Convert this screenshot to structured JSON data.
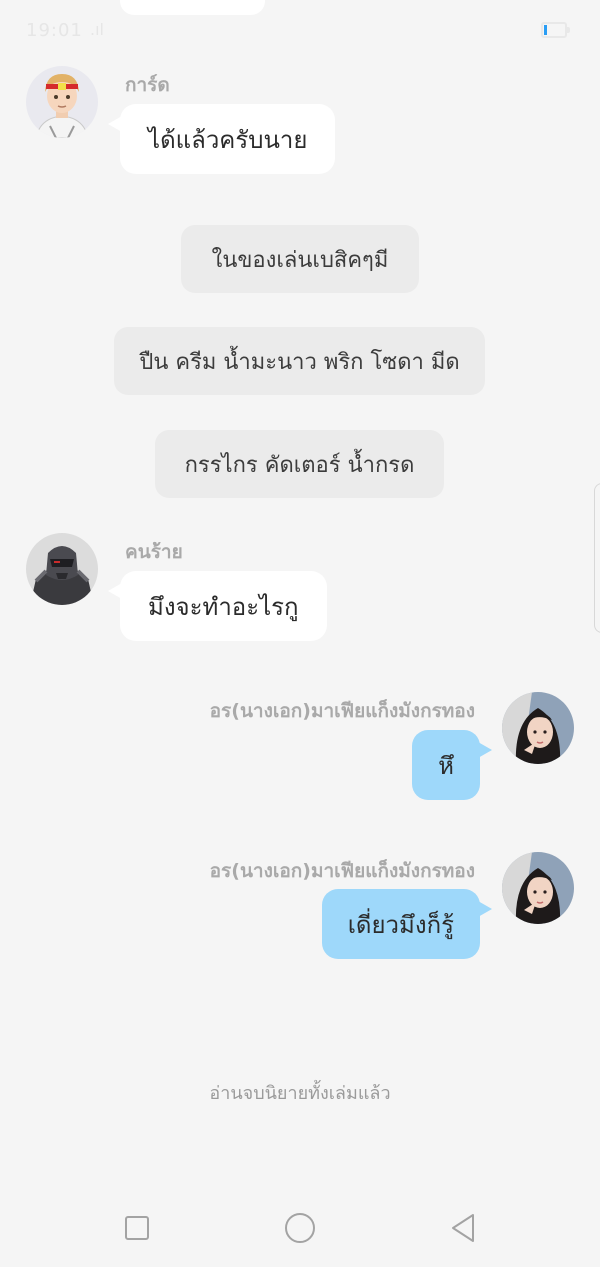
{
  "status_bar": {
    "time": "19:01",
    "signal": ".ıl"
  },
  "messages": [
    {
      "sender": "การ์ด",
      "text": "ได้แล้วครับนาย"
    },
    {
      "narration": "ในของเล่นเบสิคๆมี"
    },
    {
      "narration": "ปืน ครีม น้ำมะนาว พริก โซดา มีด"
    },
    {
      "narration": "กรรไกร คัดเตอร์ น้ำกรด"
    },
    {
      "sender": "คนร้าย",
      "text": "มึงจะทำอะไรกู"
    },
    {
      "sender": "อร(นางเอก)มาเฟียแก็งมังกรทอง",
      "text": "หึ"
    },
    {
      "sender": "อร(นางเอก)มาเฟียแก็งมังกรทอง",
      "text": "เดี่ยวมึงก็รู้"
    }
  ],
  "end_text": "อ่านจบนิยายทั้งเล่มแล้ว",
  "nav": {
    "recent_icon": "square-icon",
    "home_icon": "circle-icon",
    "back_icon": "triangle-back-icon"
  },
  "colors": {
    "background": "#f5f5f5",
    "bubble_left": "#ffffff",
    "bubble_right": "#9ed8fa",
    "narration": "#ebebeb",
    "name_text": "#a9a9a9"
  }
}
